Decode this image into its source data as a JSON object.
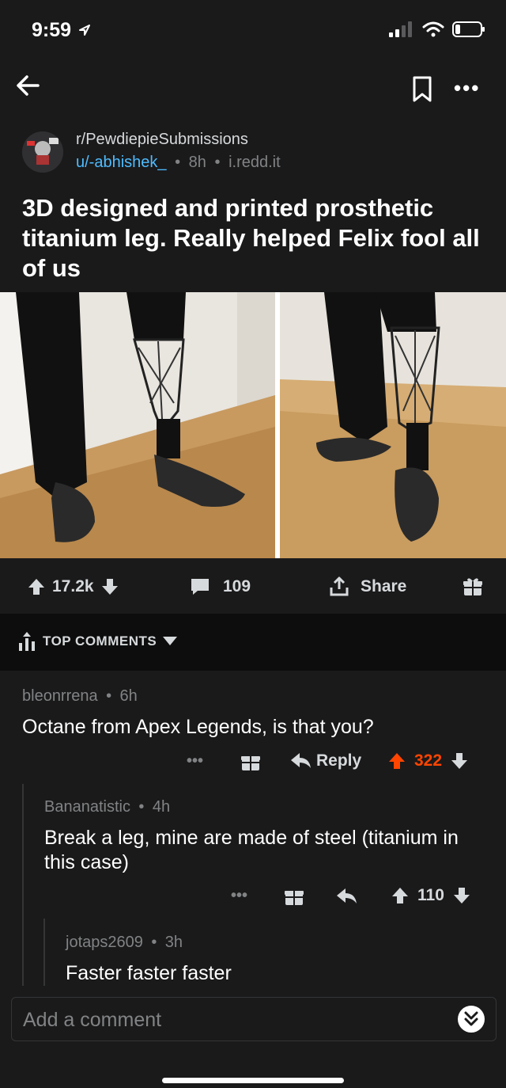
{
  "status_bar": {
    "time": "9:59"
  },
  "post": {
    "subreddit": "r/PewdiepieSubmissions",
    "author": "u/-abhishek_",
    "age": "8h",
    "domain": "i.redd.it",
    "title": "3D designed and printed prosthetic titanium leg. Really helped Felix fool all of us",
    "separator": "•"
  },
  "actions": {
    "score": "17.2k",
    "comments": "109",
    "share_label": "Share"
  },
  "sort": {
    "label": "TOP COMMENTS"
  },
  "comments": [
    {
      "author": "bleonrrena",
      "age": "6h",
      "body": "Octane from Apex Legends, is that you?",
      "reply_label": "Reply",
      "score": "322"
    },
    {
      "author": "Bananatistic",
      "age": "4h",
      "body": "Break a leg, mine are made of steel (titanium in this case)",
      "score": "110"
    },
    {
      "author": "jotaps2609",
      "age": "3h",
      "body": "Faster faster faster"
    }
  ],
  "composer": {
    "placeholder": "Add a comment"
  },
  "colors": {
    "background": "#1a1a1b",
    "link": "#4fbcff",
    "upvote": "#ff4500",
    "text": "#d7dadc",
    "muted": "#818384"
  },
  "icons": [
    "back-arrow-icon",
    "bookmark-icon",
    "more-icon",
    "upvote-icon",
    "downvote-icon",
    "comment-icon",
    "share-icon",
    "gift-icon",
    "sort-icon",
    "reply-icon",
    "collapse-icon"
  ]
}
